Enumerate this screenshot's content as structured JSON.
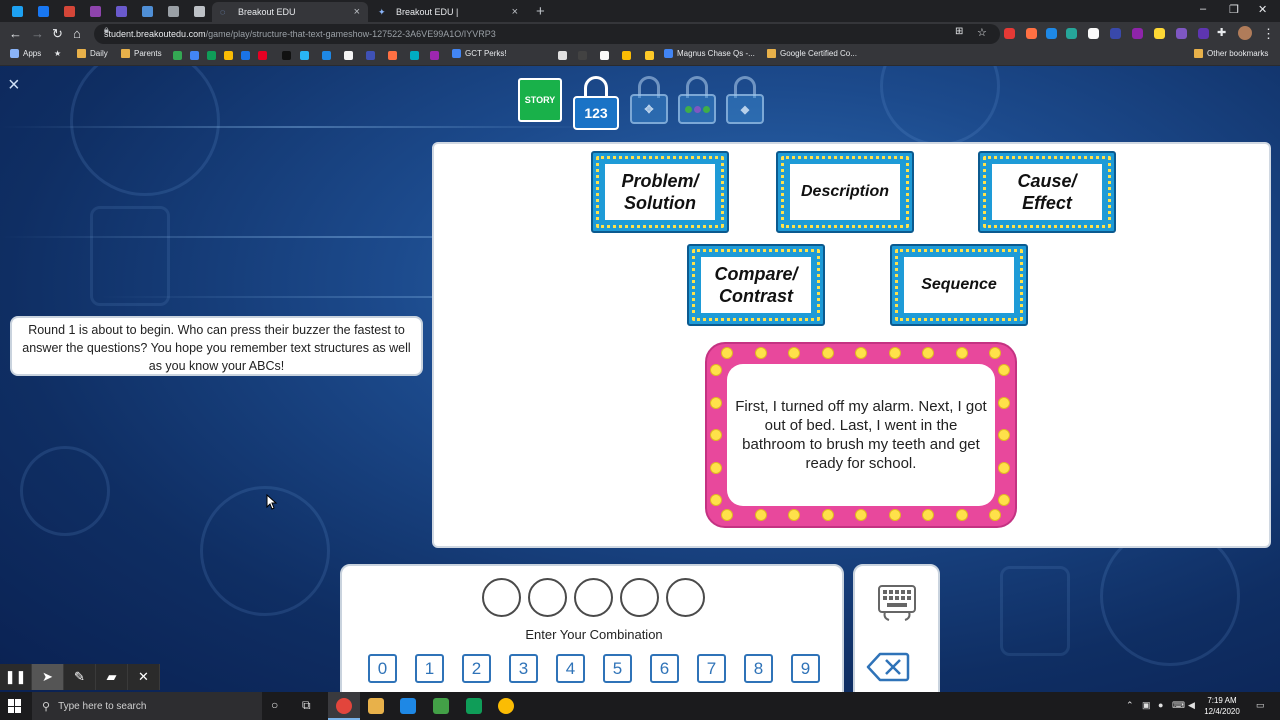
{
  "browser": {
    "tabs": [
      {
        "title": "Breakout EDU",
        "active": true
      },
      {
        "title": "Breakout EDU |",
        "active": false
      }
    ],
    "new_tab": "+",
    "close_tab": "×",
    "url_host": "student.breakoutedu.com",
    "url_path": "/game/play/structure-that-text-gameshow-127522-3A6VE99A1O/IYVRP3",
    "bookmarks": {
      "apps": "Apps",
      "daily": "Daily",
      "parents": "Parents",
      "gct_perks": "GCT Perks!",
      "magnus": "Magnus Chase Qs -...",
      "google_certified": "Google Certified Co...",
      "other": "Other bookmarks"
    }
  },
  "game": {
    "close": "×",
    "locks": {
      "story_label": "STORY",
      "numeric_label": "123"
    },
    "answers": {
      "problem_solution": [
        "Problem/",
        "Solution"
      ],
      "description": "Description",
      "cause_effect": [
        "Cause/",
        "Effect"
      ],
      "compare_contrast": [
        "Compare/",
        "Contrast"
      ],
      "sequence": "Sequence"
    },
    "prompt_text": "First, I turned off my alarm. Next, I got out of bed. Last, I went in the bathroom to brush my teeth and get ready for school.",
    "dialog_text": "Round 1 is about to begin. Who can press their buzzer the fastest to answer the questions? You hope you remember text structures as well as you know your ABCs!",
    "combination": {
      "label": "Enter Your Combination",
      "digits": [
        "0",
        "1",
        "2",
        "3",
        "4",
        "5",
        "6",
        "7",
        "8",
        "9"
      ]
    }
  },
  "taskbar": {
    "search_placeholder": "Type here to search",
    "time": "7:19 AM",
    "date": "12/4/2020"
  },
  "colors": {
    "story_green": "#19b14a",
    "lock_blue": "#1a73c6",
    "marquee_blue": "#1e9bd7",
    "bulb_yellow": "#ffe14a",
    "prompt_pink": "#e8489c"
  }
}
